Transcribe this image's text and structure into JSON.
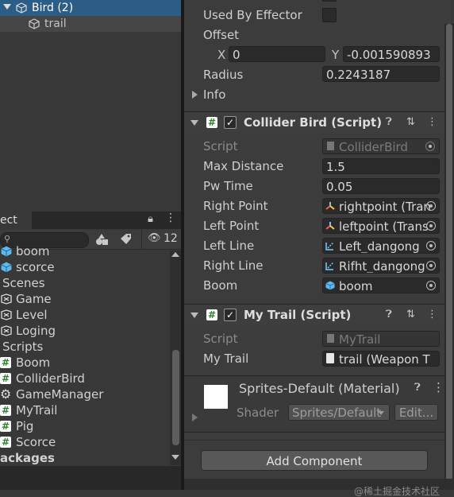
{
  "hierarchy": {
    "items": [
      {
        "label": "Bird (2)"
      },
      {
        "label": "trail"
      }
    ]
  },
  "project": {
    "tab_label": "ect",
    "hidden_count": "12",
    "items": [
      {
        "label": "boom",
        "kind": "cube"
      },
      {
        "label": "scorce",
        "kind": "cube"
      },
      {
        "label": "Scenes",
        "kind": "folder"
      },
      {
        "label": "Game",
        "kind": "scene"
      },
      {
        "label": "Level",
        "kind": "scene"
      },
      {
        "label": "Loging",
        "kind": "scene"
      },
      {
        "label": "Scripts",
        "kind": "folder"
      },
      {
        "label": "Boom",
        "kind": "script"
      },
      {
        "label": "ColliderBird",
        "kind": "script"
      },
      {
        "label": "GameManager",
        "kind": "gear"
      },
      {
        "label": "MyTrail",
        "kind": "script"
      },
      {
        "label": "Pig",
        "kind": "script"
      },
      {
        "label": "Scorce",
        "kind": "script"
      },
      {
        "label": "ackages",
        "kind": "folder-bold"
      }
    ]
  },
  "inspector": {
    "used_by_effector": "Used By Effector",
    "offset": "Offset",
    "offset_x_label": "X",
    "offset_x": "0",
    "offset_y_label": "Y",
    "offset_y": "-0.001590893",
    "radius_label": "Radius",
    "radius": "0.2243187",
    "info": "Info",
    "collider_bird": {
      "title": "Collider Bird (Script)",
      "script_label": "Script",
      "script_value": "ColliderBird",
      "max_distance_label": "Max Distance",
      "max_distance": "1.5",
      "pw_time_label": "Pw Time",
      "pw_time": "0.05",
      "right_point_label": "Right Point",
      "right_point": "rightpoint (Tran",
      "left_point_label": "Left Point",
      "left_point": "leftpoint (Trans",
      "left_line_label": "Left Line",
      "left_line": "Left_dangong",
      "right_line_label": "Right Line",
      "right_line": "Rifht_dangong",
      "boom_label": "Boom",
      "boom": "boom"
    },
    "my_trail": {
      "title": "My Trail (Script)",
      "script_label": "Script",
      "script_value": "MyTrail",
      "trail_label": "My Trail",
      "trail": "trail (Weapon T"
    },
    "material": {
      "title": "Sprites-Default (Material)",
      "shader_label": "Shader",
      "shader": "Sprites/Default",
      "edit_label": "Edit..."
    },
    "add_component": "Add Component",
    "watermark": "@稀土掘金技术社区"
  },
  "colors": {
    "selection": "#2c5d87",
    "panel": "#3c3c3c",
    "field": "#2a2a2a"
  }
}
